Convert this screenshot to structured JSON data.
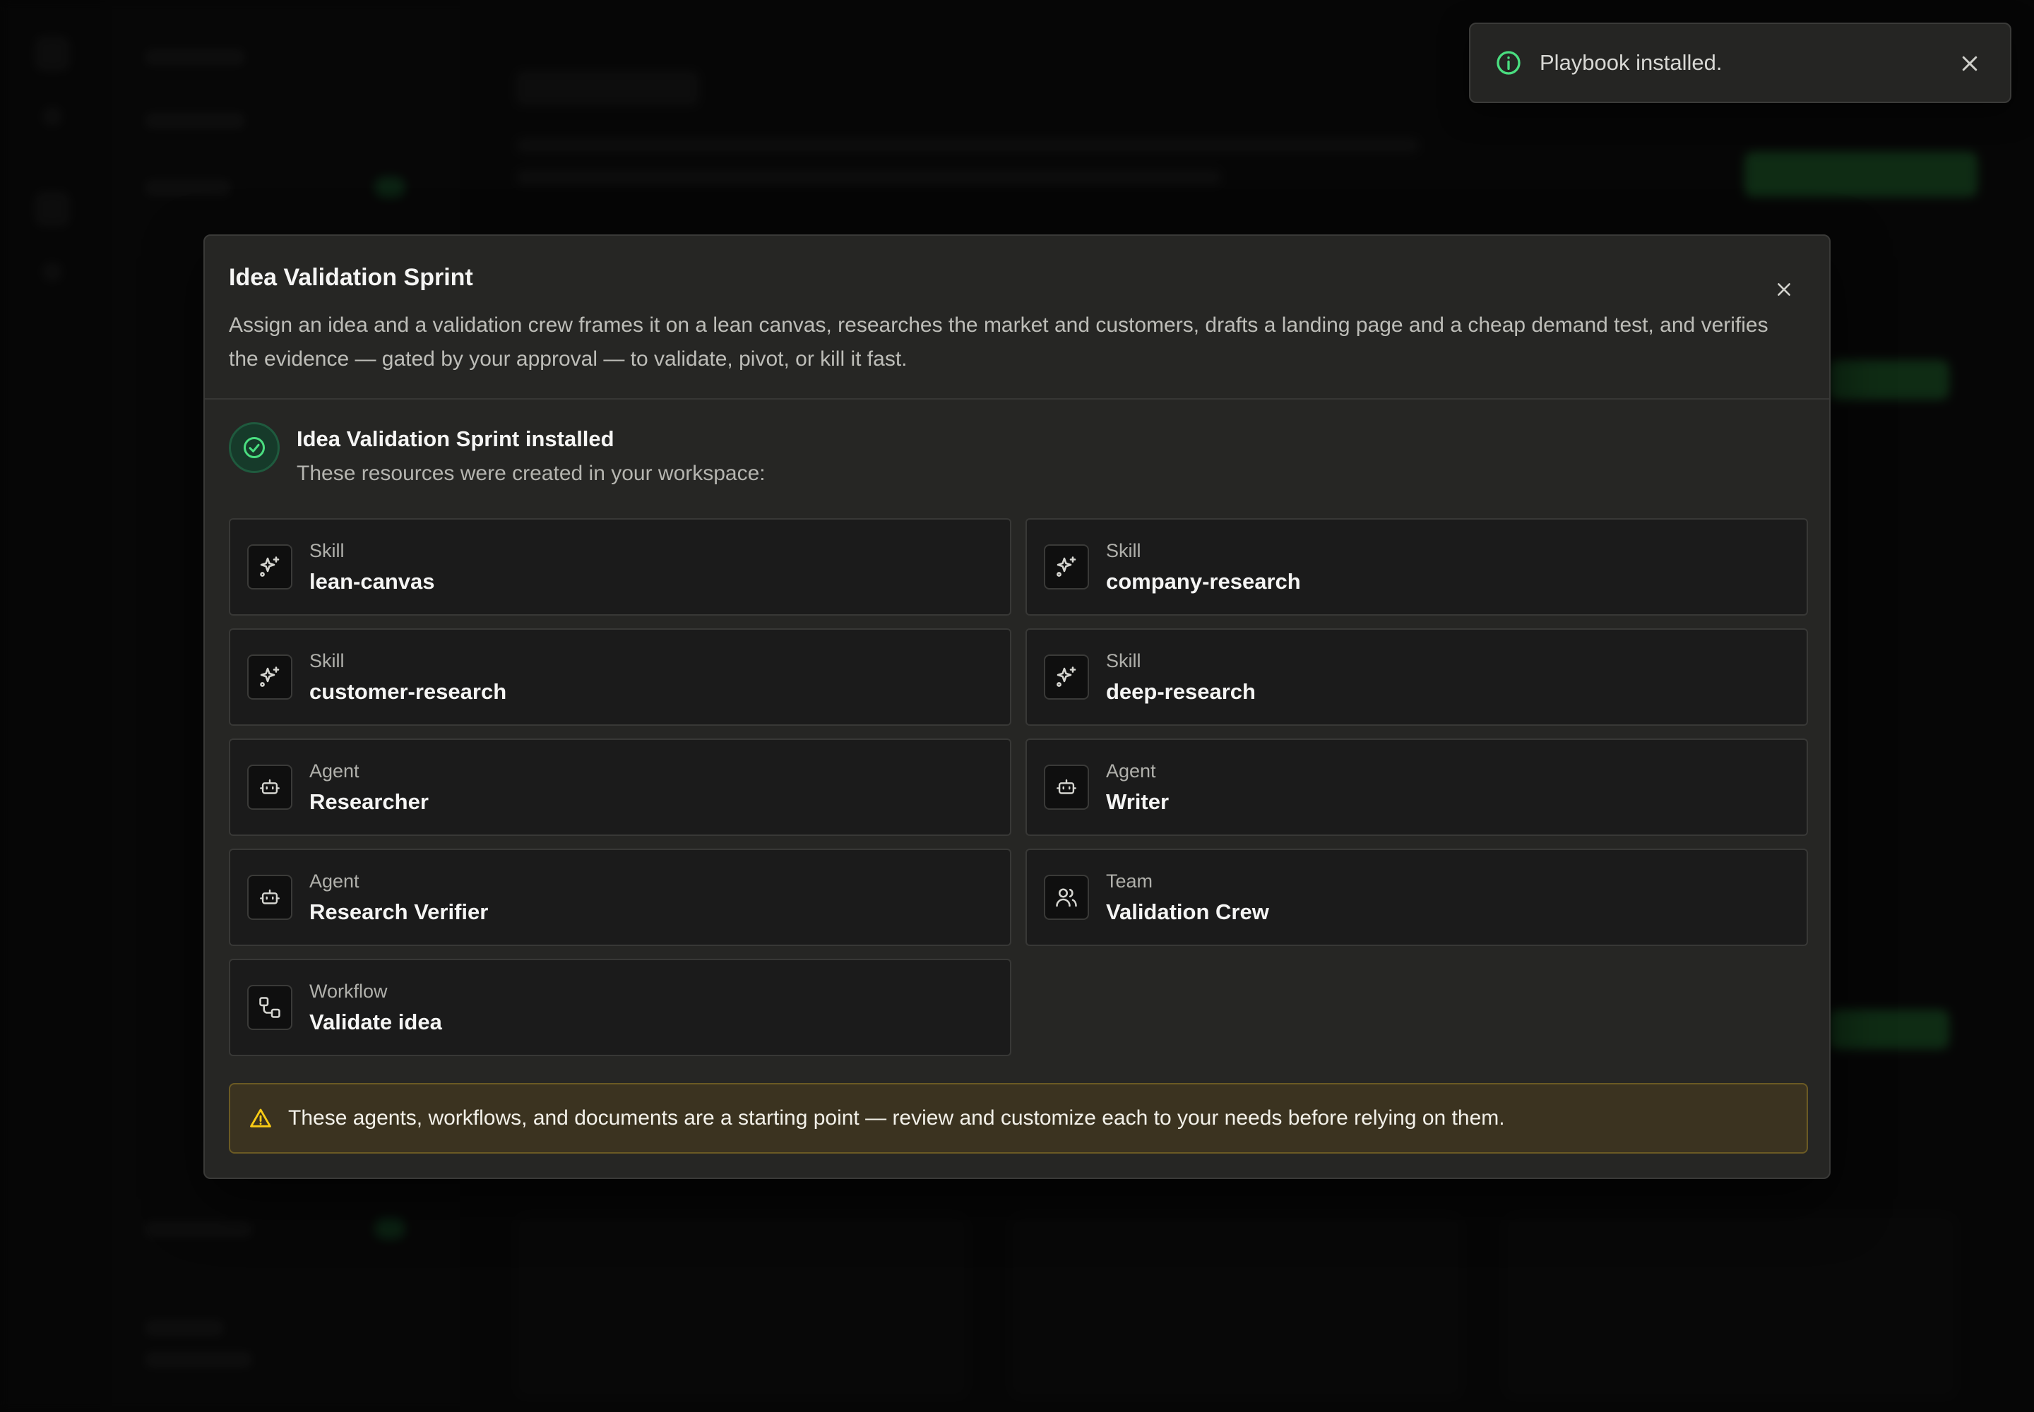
{
  "toast": {
    "message": "Playbook installed.",
    "info_icon": "info-circle-icon",
    "close_icon": "close-icon"
  },
  "modal": {
    "title": "Idea Validation Sprint",
    "description": "Assign an idea and a validation crew frames it on a lean canvas, researches the market and customers, drafts a landing page and a cheap demand test, and verifies the evidence — gated by your approval — to validate, pivot, or kill it fast.",
    "close_icon": "close-icon",
    "success": {
      "icon": "check-circle-icon",
      "title": "Idea Validation Sprint installed",
      "subtitle": "These resources were created in your workspace:"
    },
    "resources": [
      {
        "type": "Skill",
        "name": "lean-canvas",
        "icon": "sparkles-icon"
      },
      {
        "type": "Skill",
        "name": "company-research",
        "icon": "sparkles-icon"
      },
      {
        "type": "Skill",
        "name": "customer-research",
        "icon": "sparkles-icon"
      },
      {
        "type": "Skill",
        "name": "deep-research",
        "icon": "sparkles-icon"
      },
      {
        "type": "Agent",
        "name": "Researcher",
        "icon": "bot-icon"
      },
      {
        "type": "Agent",
        "name": "Writer",
        "icon": "bot-icon"
      },
      {
        "type": "Agent",
        "name": "Research Verifier",
        "icon": "bot-icon"
      },
      {
        "type": "Team",
        "name": "Validation Crew",
        "icon": "users-icon"
      },
      {
        "type": "Workflow",
        "name": "Validate idea",
        "icon": "workflow-icon"
      }
    ],
    "warning": {
      "icon": "warning-triangle-icon",
      "text": "These agents, workflows, and documents are a starting point — review and customize each to your needs before relying on them."
    }
  },
  "colors": {
    "success": "#4ade80",
    "warning": "#facc15",
    "modal_bg": "#262624"
  }
}
